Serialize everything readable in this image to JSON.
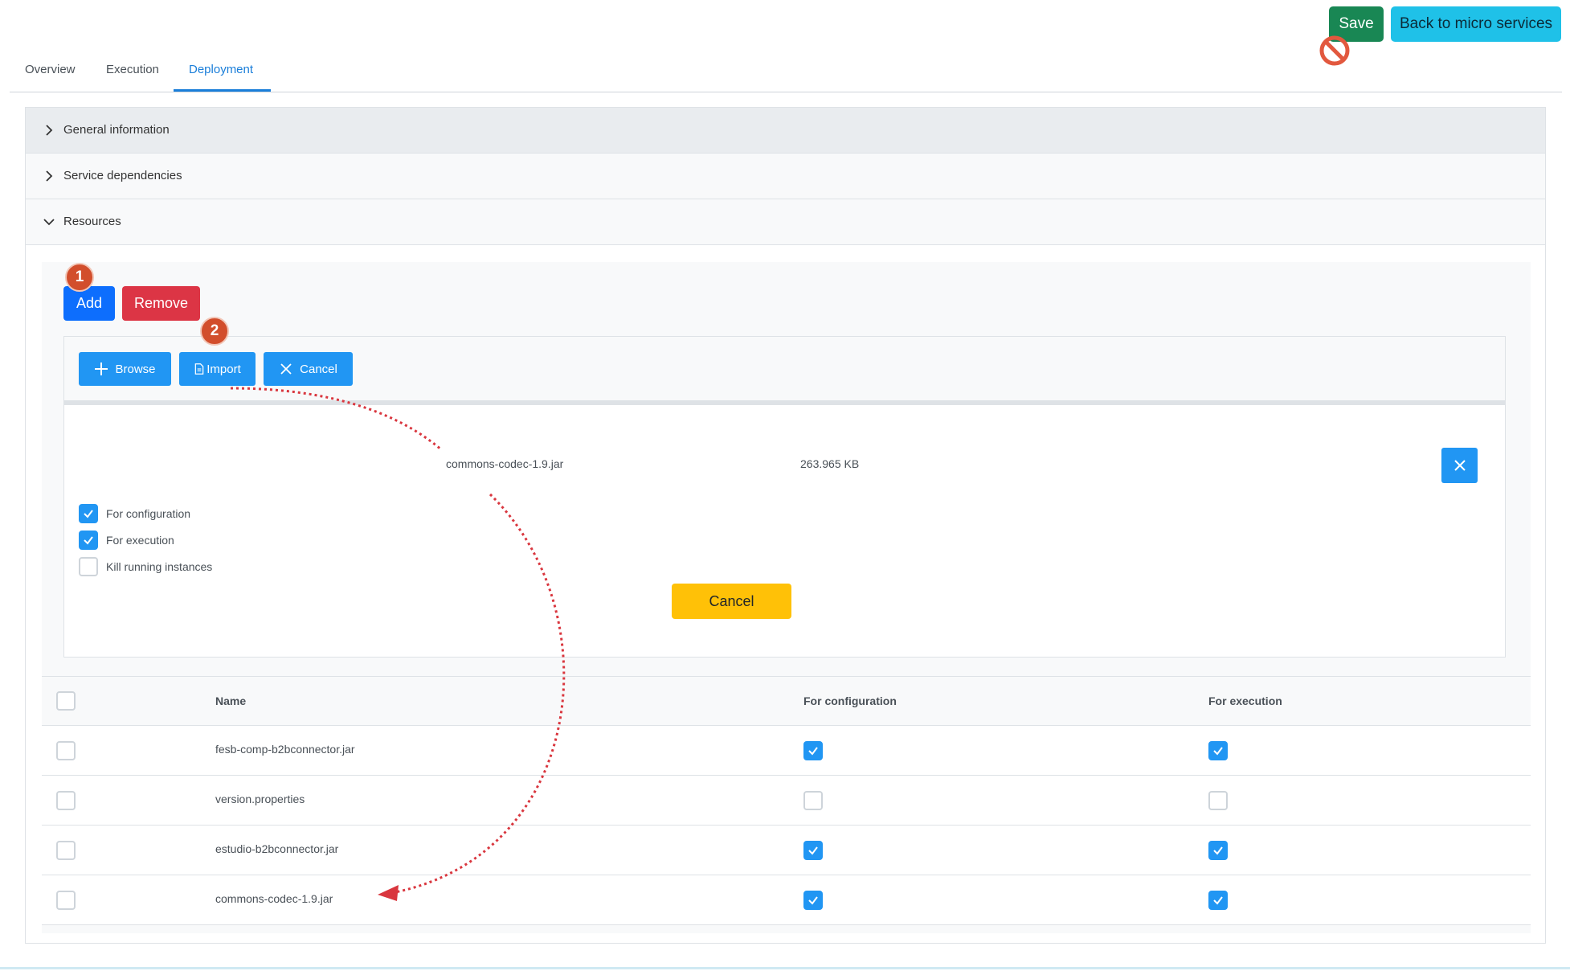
{
  "header": {
    "save_label": "Save",
    "back_label": "Back to micro services"
  },
  "tabs": [
    {
      "label": "Overview"
    },
    {
      "label": "Execution"
    },
    {
      "label": "Deployment",
      "active": true
    }
  ],
  "accordion": [
    {
      "label": "General information",
      "expanded": false
    },
    {
      "label": "Service dependencies",
      "expanded": false
    },
    {
      "label": "Resources",
      "expanded": true
    }
  ],
  "resources": {
    "add_label": "Add",
    "remove_label": "Remove",
    "badges": [
      "1",
      "2"
    ],
    "upload": {
      "browse_label": "Browse",
      "import_label": "Import",
      "cancel_label": "Cancel",
      "file": {
        "name": "commons-codec-1.9.jar",
        "size": "263.965 KB"
      },
      "options": [
        {
          "label": "For configuration",
          "checked": true
        },
        {
          "label": "For execution",
          "checked": true
        },
        {
          "label": "Kill running instances",
          "checked": false
        }
      ],
      "cancel_button_label": "Cancel"
    },
    "table": {
      "headers": [
        "Name",
        "For configuration",
        "For execution"
      ],
      "rows": [
        {
          "name": "fesb-comp-b2bconnector.jar",
          "config": true,
          "execution": true
        },
        {
          "name": "version.properties",
          "config": false,
          "execution": false
        },
        {
          "name": "estudio-b2bconnector.jar",
          "config": true,
          "execution": true
        },
        {
          "name": "commons-codec-1.9.jar",
          "config": true,
          "execution": true
        }
      ]
    }
  },
  "colors": {
    "primary": "#0d6efd",
    "danger": "#dc3545",
    "success": "#198754",
    "info": "#1fc1e8",
    "warning": "#ffc107",
    "check": "#2196f3",
    "annotation": "#d24e2c",
    "flow_arrow": "#d9363e"
  }
}
